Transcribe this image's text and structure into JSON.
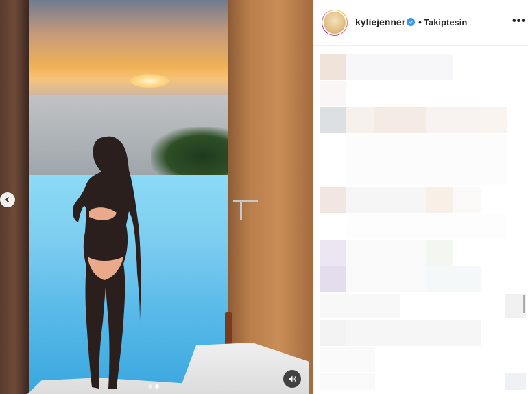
{
  "post": {
    "username": "kyliejenner",
    "separator": "•",
    "follow_status": "Takiptesin",
    "more_options_icon": "more-horizontal-icon",
    "verified_icon": "verified-badge-icon"
  },
  "media": {
    "prev_icon": "chevron-left-icon",
    "sound_icon": "speaker-icon",
    "carousel": {
      "total": 2,
      "active": 1
    }
  },
  "colors": {
    "verified": "#3897f0",
    "text_primary": "#262626",
    "divider": "#efefef"
  }
}
